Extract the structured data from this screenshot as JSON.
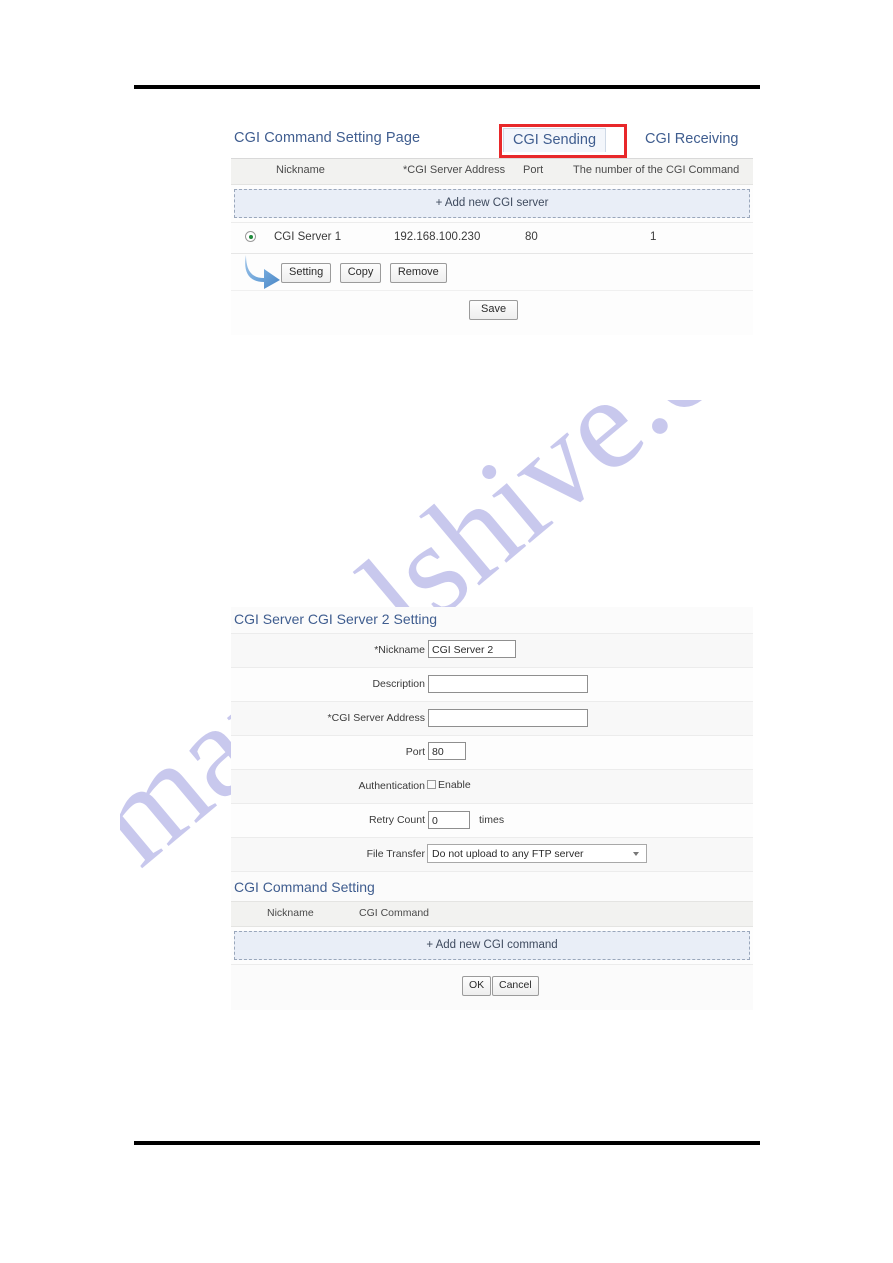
{
  "page": {
    "watermark_text": "manualshive.com",
    "watermark_color": "#b3b3e6",
    "rule_color": "#000000",
    "accent_color": "#3f5d8f",
    "highlight_color": "#e8282a"
  },
  "top_panel": {
    "title": "CGI Command Setting Page",
    "tabs": [
      {
        "label": "CGI Sending",
        "active": true,
        "highlighted": true
      },
      {
        "label": "CGI Receiving",
        "active": false,
        "highlighted": false
      }
    ],
    "columns": {
      "nickname": "Nickname",
      "address": "*CGI Server Address",
      "port": "Port",
      "command_count": "The number of the CGI Command"
    },
    "add_server_label": "+ Add new CGI server",
    "rows": [
      {
        "selected": true,
        "nickname": "CGI Server 1",
        "address": "192.168.100.230",
        "port": "80",
        "command_count": "1"
      }
    ],
    "row_buttons": {
      "setting": "Setting",
      "copy": "Copy",
      "remove": "Remove"
    },
    "save_label": "Save"
  },
  "bottom_panel": {
    "title": "CGI Server CGI Server 2 Setting",
    "fields": {
      "nickname_label": "*Nickname",
      "nickname_value": "CGI Server 2",
      "description_label": "Description",
      "description_value": "",
      "address_label": "*CGI Server Address",
      "address_value": "",
      "port_label": "Port",
      "port_value": "80",
      "authentication_label": "Authentication",
      "authentication_enable_label": "Enable",
      "authentication_checked": false,
      "retry_label": "Retry Count",
      "retry_value": "0",
      "retry_suffix": "times",
      "file_transfer_label": "File Transfer",
      "file_transfer_value": "Do not upload to any FTP server"
    },
    "command_section": {
      "title": "CGI Command Setting",
      "columns": {
        "nickname": "Nickname",
        "command": "CGI Command"
      },
      "add_command_label": "+ Add new CGI command"
    },
    "buttons": {
      "ok": "OK",
      "cancel": "Cancel"
    }
  }
}
